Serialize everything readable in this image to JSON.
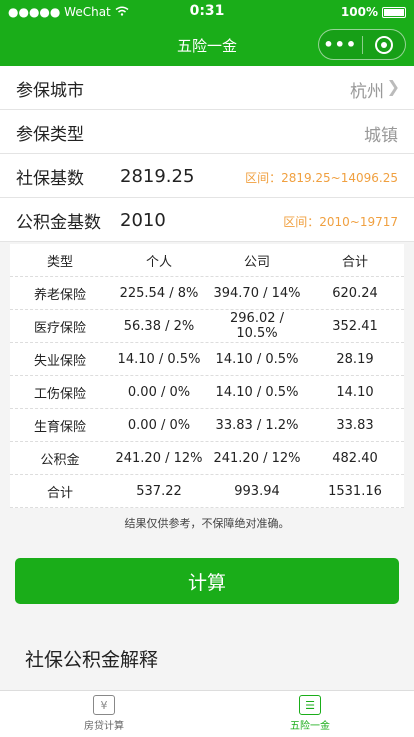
{
  "status_bar": {
    "carrier": "●●●●● WeChat",
    "time": "0:31",
    "battery": "100%"
  },
  "nav": {
    "title": "五险一金",
    "more_icon": "more-dots-icon",
    "close_icon": "target-icon"
  },
  "form": {
    "city_label": "参保城市",
    "city_value": "杭州",
    "type_label": "参保类型",
    "type_value": "城镇",
    "social_label": "社保基数",
    "social_value": "2819.25",
    "social_range": "区间：2819.25~14096.25",
    "fund_label": "公积金基数",
    "fund_value": "2010",
    "fund_range": "区间：2010~19717"
  },
  "table": {
    "headers": [
      "类型",
      "个人",
      "公司",
      "合计"
    ],
    "rows": [
      [
        "养老保险",
        "225.54 / 8%",
        "394.70 / 14%",
        "620.24"
      ],
      [
        "医疗保险",
        "56.38 / 2%",
        "296.02 / 10.5%",
        "352.41"
      ],
      [
        "失业保险",
        "14.10 / 0.5%",
        "14.10 / 0.5%",
        "28.19"
      ],
      [
        "工伤保险",
        "0.00 / 0%",
        "14.10 / 0.5%",
        "14.10"
      ],
      [
        "生育保险",
        "0.00 / 0%",
        "33.83 / 1.2%",
        "33.83"
      ],
      [
        "公积金",
        "241.20 / 12%",
        "241.20 / 12%",
        "482.40"
      ],
      [
        "合计",
        "537.22",
        "993.94",
        "1531.16"
      ]
    ]
  },
  "note": "结果仅供参考，不保障绝对准确。",
  "calc_button": "计算",
  "section_title": "社保公积金解释",
  "tabs": {
    "tab1_label": "房贷计算",
    "tab2_label": "五险一金"
  },
  "colors": {
    "primary": "#1aad19",
    "range": "#f0a040"
  }
}
